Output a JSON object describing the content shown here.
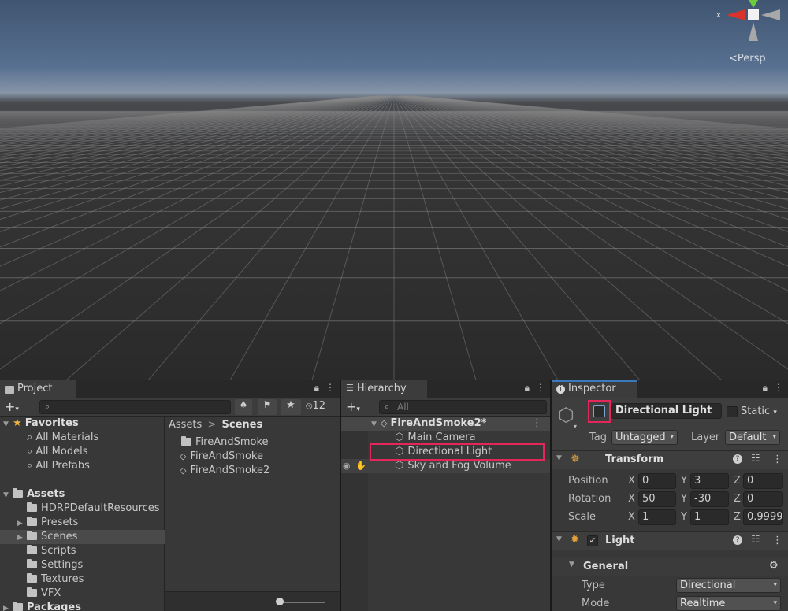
{
  "scene": {
    "camera_mode": "Persp",
    "gizmo_x_label": "x"
  },
  "project": {
    "tab_label": "Project",
    "hidden_count": "12",
    "favorites": {
      "label": "Favorites",
      "items": [
        "All Materials",
        "All Models",
        "All Prefabs"
      ]
    },
    "assets": {
      "label": "Assets",
      "items": [
        "HDRPDefaultResources",
        "Presets",
        "Scenes",
        "Scripts",
        "Settings",
        "Textures",
        "VFX"
      ]
    },
    "packages_label": "Packages",
    "breadcrumb": {
      "root": "Assets",
      "separator": ">",
      "current": "Scenes"
    },
    "files": [
      "FireAndSmoke",
      "FireAndSmoke",
      "FireAndSmoke2"
    ]
  },
  "hierarchy": {
    "tab_label": "Hierarchy",
    "search_placeholder": "All",
    "scene_name": "FireAndSmoke2*",
    "objects": [
      "Main Camera",
      "Directional Light",
      "Sky and Fog Volume"
    ]
  },
  "inspector": {
    "tab_label": "Inspector",
    "object_name": "Directional Light",
    "static_label": "Static",
    "tag_label": "Tag",
    "tag_value": "Untagged",
    "layer_label": "Layer",
    "layer_value": "Default",
    "transform": {
      "title": "Transform",
      "position_label": "Position",
      "rotation_label": "Rotation",
      "scale_label": "Scale",
      "axes": [
        "X",
        "Y",
        "Z"
      ],
      "position": [
        "0",
        "3",
        "0"
      ],
      "rotation": [
        "50",
        "-30",
        "0"
      ],
      "scale": [
        "1",
        "1",
        "0.9999"
      ]
    },
    "light": {
      "title": "Light",
      "general_label": "General",
      "type_label": "Type",
      "type_value": "Directional",
      "mode_label": "Mode",
      "mode_value": "Realtime"
    }
  },
  "colors": {
    "highlight": "#e5265b",
    "accent": "#3a79bb",
    "panel_bg": "#383838"
  }
}
